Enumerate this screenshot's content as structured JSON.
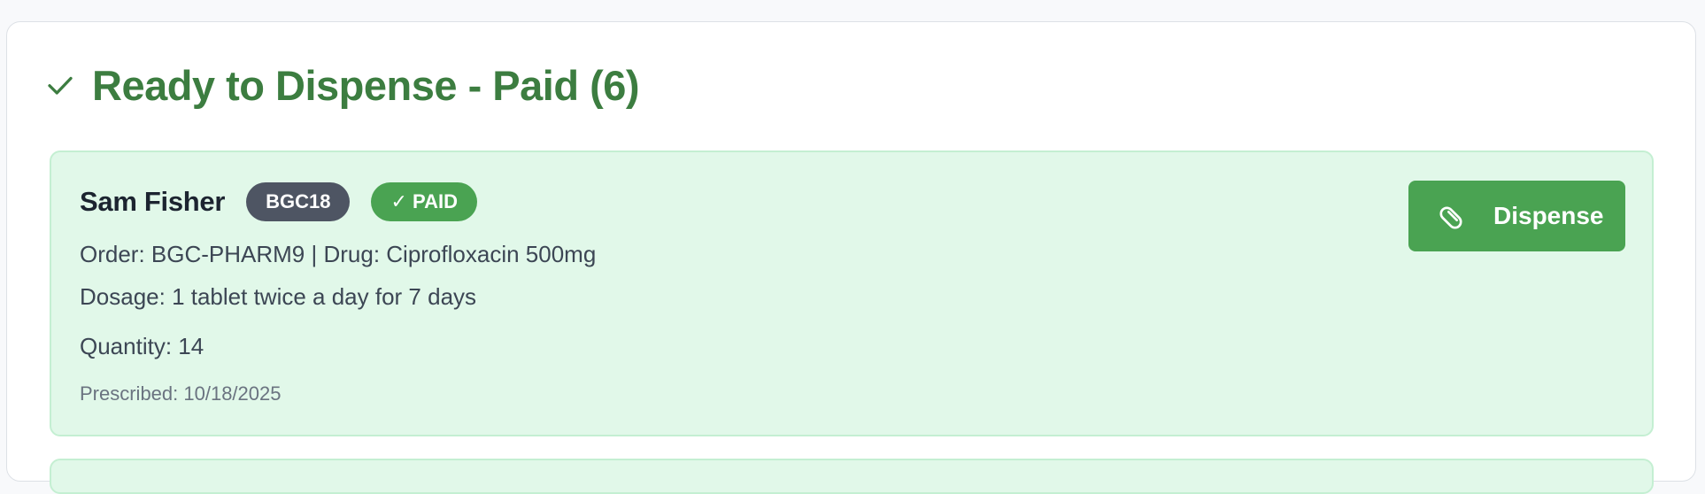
{
  "section": {
    "title": "Ready to Dispense - Paid (6)",
    "icon": "checkmark-icon",
    "accent_color": "#3c7d40"
  },
  "order": {
    "patient_name": "Sam Fisher",
    "patient_id_badge": "BGC18",
    "payment_status": "✓ PAID",
    "order_line": "Order: BGC-PHARM9 | Drug: Ciprofloxacin 500mg",
    "dosage_line": "Dosage: 1 tablet twice a day for 7 days",
    "quantity_line": "Quantity: 14",
    "prescribed_line": "Prescribed: 10/18/2025",
    "action": {
      "label": "Dispense",
      "icon": "pill-icon",
      "color": "#4aa352"
    },
    "card_color": "#e1f8e9"
  }
}
